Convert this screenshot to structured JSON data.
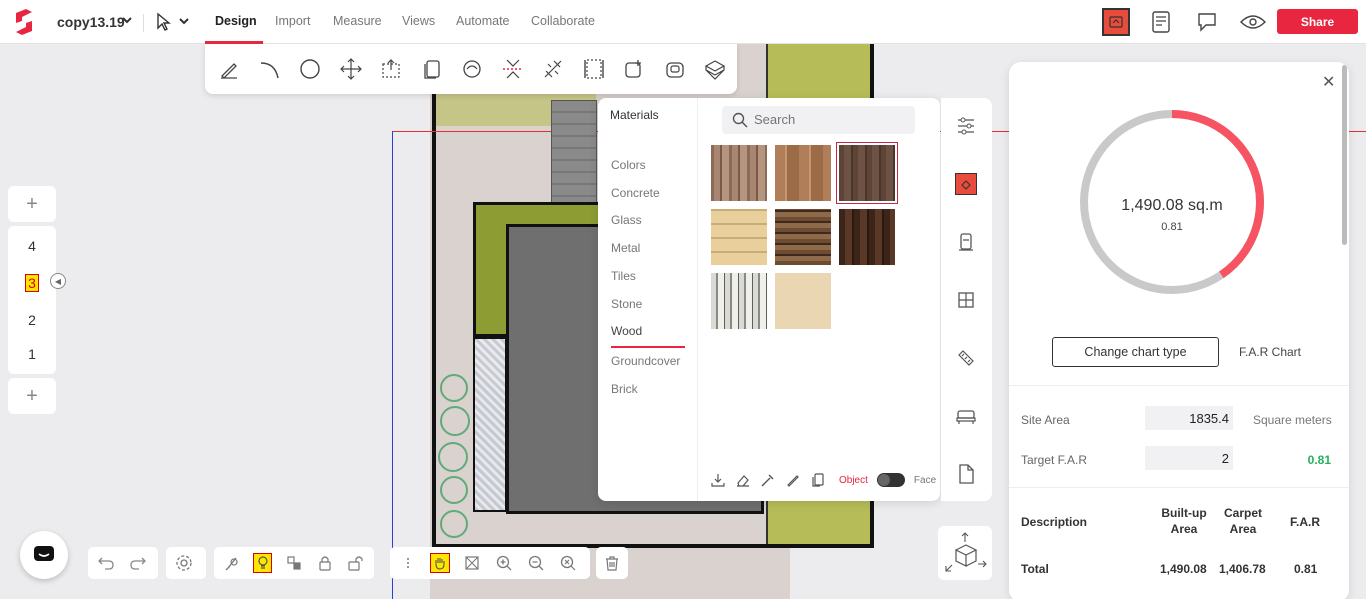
{
  "app": {
    "project_name": "copy13.19",
    "tabs": [
      "Design",
      "Import",
      "Measure",
      "Views",
      "Automate",
      "Collaborate"
    ],
    "active_tab": "Design",
    "share_label": "Share",
    "accent_color": "#e8263f"
  },
  "design_toolbar": {
    "tools": [
      "pencil-icon",
      "arc-icon",
      "circle-icon",
      "move-icon",
      "transform-icon",
      "copy-icon",
      "rotate-icon",
      "mirror-icon",
      "split-icon",
      "resize-icon",
      "add-shape-icon",
      "offset-icon",
      "extrude-icon"
    ]
  },
  "floors": {
    "levels": [
      "4",
      "3",
      "2",
      "1"
    ],
    "selected": "3"
  },
  "materials": {
    "title": "Materials",
    "search_placeholder": "Search",
    "categories": [
      "Colors",
      "Concrete",
      "Glass",
      "Metal",
      "Tiles",
      "Stone",
      "Wood",
      "Groundcover",
      "Brick"
    ],
    "active_category": "Wood",
    "object_label": "Object",
    "face_label": "Face"
  },
  "far_panel": {
    "chart_value": "1,490.08 sq.m",
    "chart_ratio": "0.81",
    "chart_fraction": 0.405,
    "chart_type_button": "Change chart type",
    "chart_label": "F.A.R Chart",
    "site_area_label": "Site Area",
    "site_area_value": "1835.4",
    "site_area_unit": "Square meters",
    "target_far_label": "Target F.A.R",
    "target_far_value": "2",
    "current_far": "0.81",
    "table": {
      "headers": [
        "Description",
        "Built-up Area",
        "Carpet Area",
        "F.A.R"
      ],
      "rows": [
        {
          "description": "Total",
          "built_up": "1,490.08",
          "carpet": "1,406.78",
          "far": "0.81"
        }
      ]
    }
  }
}
